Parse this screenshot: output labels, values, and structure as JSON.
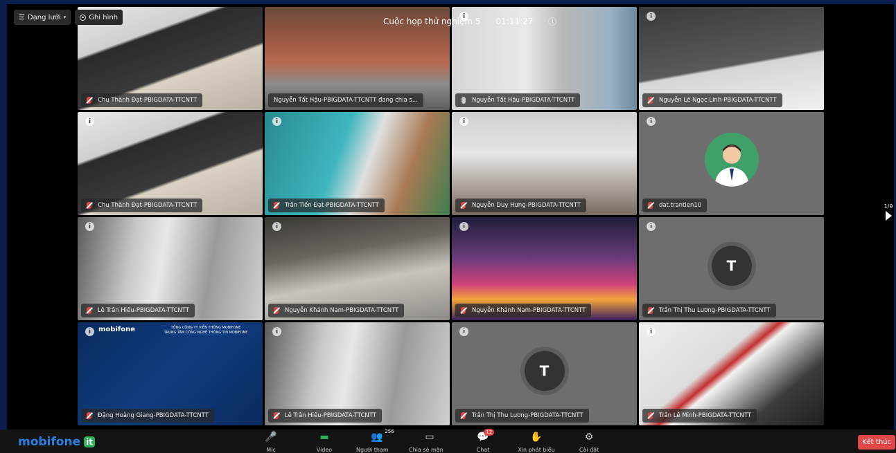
{
  "toolbar_top": {
    "layout_label": "Dạng lưới",
    "record_label": "Ghi hình"
  },
  "meeting": {
    "title": "Cuộc họp thử nghiệm 5",
    "timer": "01:11:27"
  },
  "tiles": [
    {
      "name": "Chu Thành Đạt-PBIGDATA-TTCNTT",
      "mic": "off",
      "scene": "office-monitors",
      "info": false
    },
    {
      "name": "Nguyễn Tất Hậu-PBIGDATA-TTCNTT đang chia s...",
      "mic": "none",
      "scene": "speaker-shared",
      "info": false
    },
    {
      "name": "Nguyễn Tất Hậu-PBIGDATA-TTCNTT",
      "mic": "on",
      "scene": "man-office",
      "info": true
    },
    {
      "name": "Nguyễn Lê Ngọc Linh-PBIGDATA-TTCNTT",
      "mic": "off",
      "scene": "desk-monitor",
      "info": true
    },
    {
      "name": "Chu Thành Đạt-PBIGDATA-TTCNTT",
      "mic": "off",
      "scene": "office-monitors",
      "info": true
    },
    {
      "name": "Trần Tiến Đạt-PBIGDATA-TTCNTT",
      "mic": "off",
      "scene": "teal-office",
      "info": true
    },
    {
      "name": "Nguyễn Duy Hưng-PBIGDATA-TTCNTT",
      "mic": "off",
      "scene": "ceiling-lights",
      "info": true
    },
    {
      "name": "dat.trantien10",
      "mic": "off",
      "scene": "avatar-person",
      "info": true
    },
    {
      "name": "Lê Trần Hiếu-PBIGDATA-TTCNTT",
      "mic": "off",
      "scene": "room-light",
      "info": true
    },
    {
      "name": "Nguyễn Khánh Nam-PBIGDATA-TTCNTT",
      "mic": "off",
      "scene": "ceiling-lamp",
      "info": true
    },
    {
      "name": "Nguyễn Khánh Nam-PBIGDATA-TTCNTT",
      "mic": "off",
      "scene": "astronaut",
      "info": true
    },
    {
      "name": "Trần Thị Thu Lương-PBIGDATA-TTCNTT",
      "mic": "off",
      "scene": "letter",
      "letter": "T",
      "info": true
    },
    {
      "name": "Đặng Hoàng Giang-PBIGDATA-TTCNTT",
      "mic": "off",
      "scene": "mobifone-bg",
      "info": true,
      "bg_logo": "mobifone",
      "bg_line1": "TỔNG CÔNG TY VIỄN THÔNG MOBIFONE",
      "bg_line2": "TRUNG TÂM CÔNG NGHỆ THÔNG TIN MOBIFONE"
    },
    {
      "name": "Lê Trần Hiếu-PBIGDATA-TTCNTT",
      "mic": "off",
      "scene": "room-light",
      "info": true
    },
    {
      "name": "Trần Thị Thu Lương-PBIGDATA-TTCNTT",
      "mic": "off",
      "scene": "letter",
      "letter": "T",
      "info": true
    },
    {
      "name": "Trần Lê Minh-PBIGDATA-TTCNTT",
      "mic": "off",
      "scene": "office-corner",
      "info": true
    }
  ],
  "pagination": {
    "label": "1/9"
  },
  "bottombar": {
    "logo_text": "mobifone",
    "logo_badge": "it",
    "tools": [
      {
        "label": "Mic",
        "icon": "mic-off-icon"
      },
      {
        "label": "Video",
        "icon": "video-icon"
      },
      {
        "label": "Người tham gia",
        "icon": "participants-icon",
        "count": "256"
      },
      {
        "label": "Chia sẻ màn hình",
        "icon": "share-screen-icon"
      },
      {
        "label": "Chat",
        "icon": "chat-icon",
        "badge": "12"
      },
      {
        "label": "Xin phát biểu",
        "icon": "raise-hand-icon"
      },
      {
        "label": "Cài đặt",
        "icon": "gear-icon"
      }
    ],
    "end_label": "Kết thúc"
  }
}
